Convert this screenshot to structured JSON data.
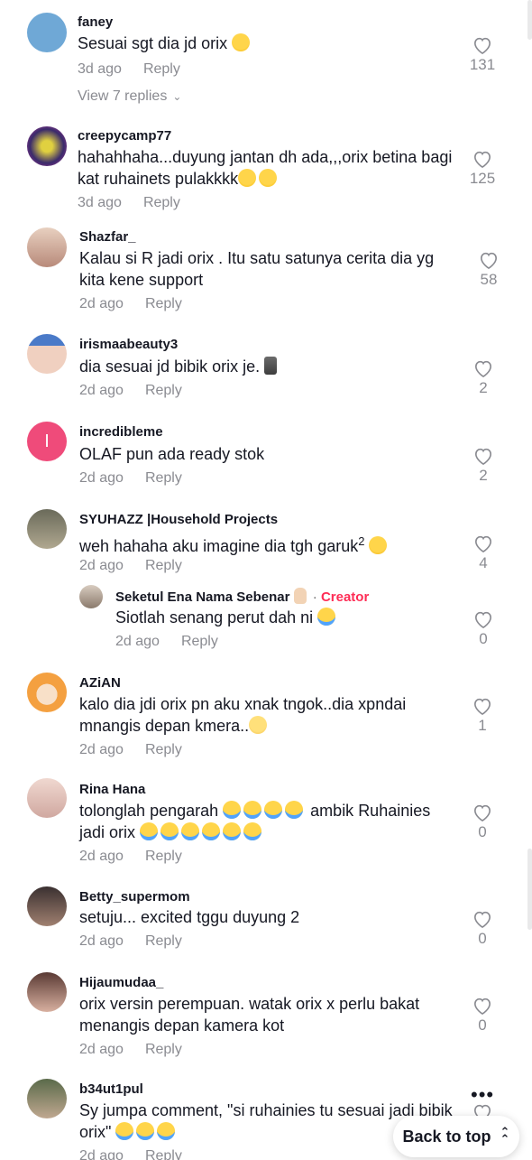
{
  "comments": [
    {
      "username": "faney",
      "text": "Sesuai sgt dia jd orix",
      "emoji": "laugh",
      "time": "3d ago",
      "reply": "Reply",
      "likes": "131",
      "view_replies": "View 7 replies",
      "avatar_color": "#6fa8d6"
    },
    {
      "username": "creepycamp77",
      "text": "hahahhaha...duyung jantan dh ada,,,orix betina bagi kat ruhainets pulakkkk",
      "emoji": "rofl",
      "time": "3d ago",
      "reply": "Reply",
      "likes": "125",
      "avatar_color": "#3a2a6b"
    },
    {
      "username": "Shazfar_",
      "text": "Kalau si R jadi orix . Itu satu satunya cerita dia yg kita kene support",
      "time": "2d ago",
      "reply": "Reply",
      "likes": "58",
      "avatar_color": "#c9a08a"
    },
    {
      "username": "irismaabeauty3",
      "text": "dia sesuai jd bibik orix je.",
      "emoji": "moai",
      "time": "2d ago",
      "reply": "Reply",
      "likes": "2",
      "avatar_color": "#9fc3e8"
    },
    {
      "username": "incredibleme",
      "text": "OLAF pun ada ready stok",
      "time": "2d ago",
      "reply": "Reply",
      "likes": "2",
      "avatar_letter": "I",
      "avatar_color": "#ef4b7a"
    },
    {
      "username": "SYUHAZZ |Household Projects",
      "text": "weh hahaha aku imagine dia tgh garuk",
      "superscript": "2",
      "emoji": "grin",
      "time": "2d ago",
      "reply": "Reply",
      "likes": "4",
      "avatar_color": "#8a8a7a"
    },
    {
      "username": "Seketul Ena Nama Sebenar",
      "creator_label": "Creator",
      "text": "Siotlah senang perut dah ni",
      "emoji": "cry",
      "time": "2d ago",
      "reply": "Reply",
      "likes": "0",
      "avatar_color": "#a89a8c"
    },
    {
      "username": "AZiAN",
      "text": "kalo dia jdi orix pn aku xnak tngok..dia xpndai mnangis depan kmera..",
      "emoji": "relieved",
      "time": "2d ago",
      "reply": "Reply",
      "likes": "1",
      "avatar_color": "#f4b55a"
    },
    {
      "username": "Rina Hana",
      "text_line1": "tolonglah pengarah",
      "text_line1b": "ambik Ruhainies",
      "text_line2": "jadi orix",
      "time": "2d ago",
      "reply": "Reply",
      "likes": "0",
      "avatar_color": "#e8c8c0"
    },
    {
      "username": "Betty_supermom",
      "text": "setuju... excited tggu duyung 2",
      "time": "2d ago",
      "reply": "Reply",
      "likes": "0",
      "avatar_color": "#5a4a46"
    },
    {
      "username": "Hijaumudaa_",
      "text": "orix versin perempuan. watak orix x perlu bakat menangis depan kamera kot",
      "time": "2d ago",
      "reply": "Reply",
      "likes": "0",
      "avatar_color": "#7a5a54"
    },
    {
      "username": "b34ut1pul",
      "text": "Sy jumpa comment, \"si ruhainies tu sesuai jadi bibik orix\"",
      "time": "2d ago",
      "reply": "Reply",
      "avatar_color": "#6a7a5a"
    }
  ],
  "creator_dot": "·",
  "more_icon": "•••",
  "back_to_top": "Back to top"
}
